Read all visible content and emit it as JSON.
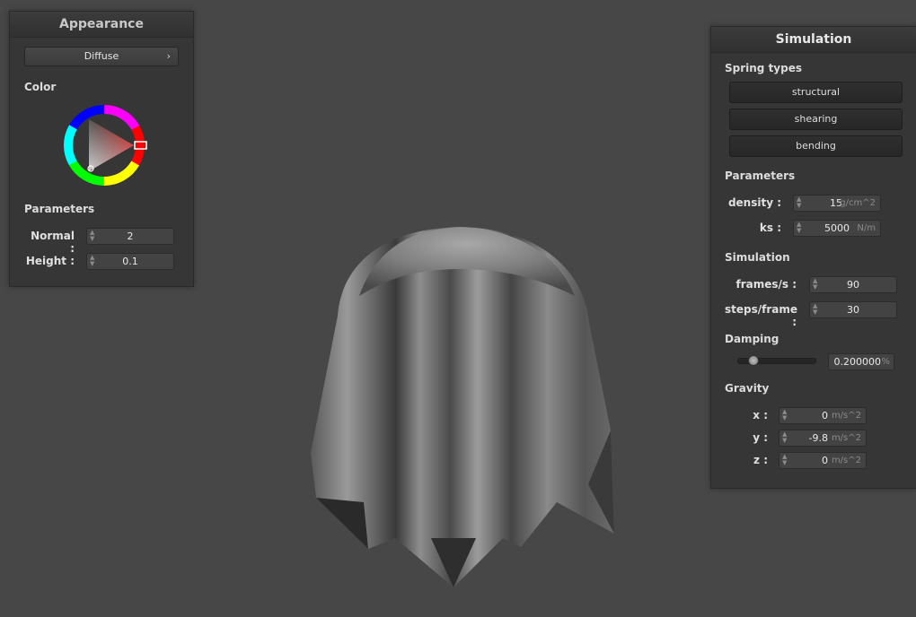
{
  "appearance": {
    "title": "Appearance",
    "shader_dropdown": "Diffuse",
    "color_label": "Color",
    "color_value": "#d42a2a",
    "parameters_label": "Parameters",
    "normal": {
      "label": "Normal :",
      "value": "2"
    },
    "height": {
      "label": "Height :",
      "value": "0.1"
    }
  },
  "simulation": {
    "title": "Simulation",
    "spring_types_label": "Spring types",
    "spring_buttons": [
      "structural",
      "shearing",
      "bending"
    ],
    "parameters_label": "Parameters",
    "density": {
      "label": "density :",
      "value": "15",
      "unit": "g/cm^2"
    },
    "ks": {
      "label": "ks :",
      "value": "5000",
      "unit": "N/m"
    },
    "simulation_label": "Simulation",
    "frames": {
      "label": "frames/s :",
      "value": "90"
    },
    "steps": {
      "label": "steps/frame :",
      "value": "30"
    },
    "damping_label": "Damping",
    "damping": {
      "value": "0.200000",
      "unit": "%",
      "level": 0.2
    },
    "gravity_label": "Gravity",
    "gravity_x": {
      "label": "x :",
      "value": "0",
      "unit": "m/s^2"
    },
    "gravity_y": {
      "label": "y :",
      "value": "-9.8",
      "unit": "m/s^2"
    },
    "gravity_z": {
      "label": "z :",
      "value": "0",
      "unit": "m/s^2"
    }
  },
  "viewport": {
    "background": "#474747",
    "object": "cloth-draped-over-sphere"
  }
}
